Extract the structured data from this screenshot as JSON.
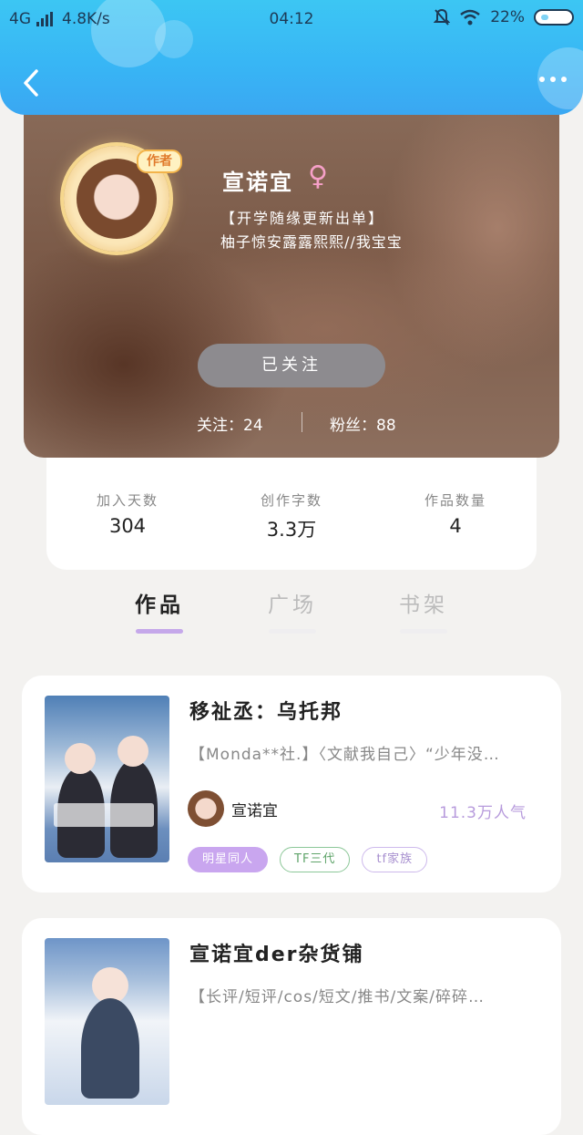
{
  "status_bar": {
    "network": "4G",
    "speed": "4.8K/s",
    "time": "04:12",
    "battery": "22%"
  },
  "header": {
    "back_icon": "chevron-left-icon",
    "more_icon": "more-dots-icon"
  },
  "profile": {
    "badge": "作者",
    "name": "宣诺宜",
    "gender_symbol": "♀",
    "bio_line1": "【开学随缘更新出单】",
    "bio_line2": "柚子惊安露露熙熙//我宝宝",
    "follow_button": "已关注",
    "following": "关注：24",
    "fans": "粉丝：88"
  },
  "stats": [
    {
      "label": "加入天数",
      "value": "304"
    },
    {
      "label": "创作字数",
      "value": "3.3万"
    },
    {
      "label": "作品数量",
      "value": "4"
    }
  ],
  "tabs": [
    {
      "label": "作品",
      "active": true
    },
    {
      "label": "广场",
      "active": false
    },
    {
      "label": "书架",
      "active": false
    }
  ],
  "works": [
    {
      "title": "移祉丞：乌托邦",
      "desc": "【Monda**社.】〈文献我自己〉“少年没…",
      "author": "宣诺宜",
      "popularity": "11.3万人气",
      "tags": [
        "明星同人",
        "TF三代",
        "tf家族"
      ]
    },
    {
      "title": "宣诺宜der杂货铺",
      "desc": "【长评/短评/cos/短文/推书/文案/碎碎…"
    }
  ]
}
